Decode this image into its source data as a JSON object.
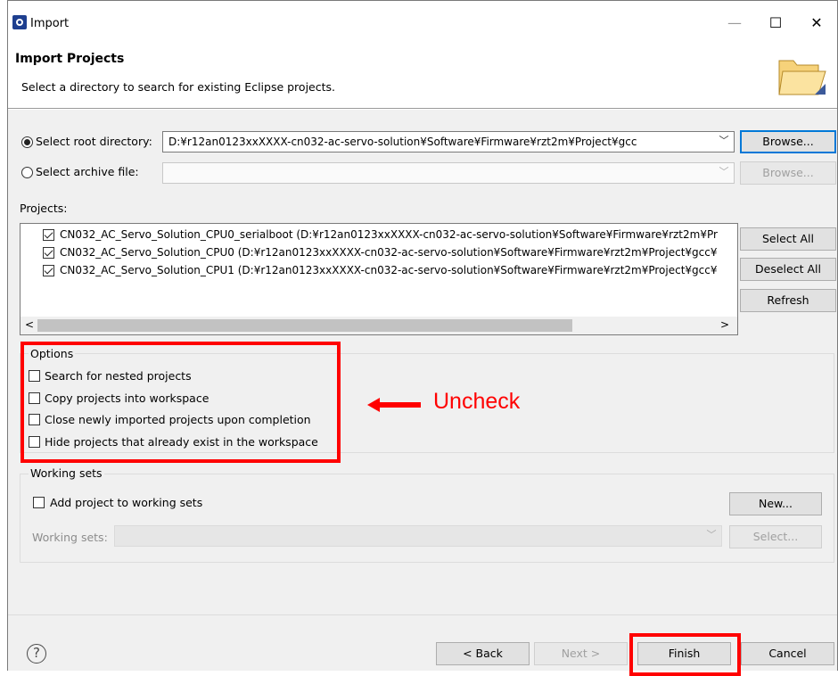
{
  "window": {
    "title": "Import",
    "minimize": "—",
    "maximize": "☐",
    "close": "✕"
  },
  "header": {
    "title": "Import Projects",
    "description": "Select a directory to search for existing Eclipse projects."
  },
  "source": {
    "root_label": "Select root directory:",
    "root_value": "D:¥r12an0123xxXXXX-cn032-ac-servo-solution¥Software¥Firmware¥rzt2m¥Project¥gcc",
    "archive_label": "Select archive file:",
    "archive_value": "",
    "browse_label": "Browse...",
    "browse_archive_label": "Browse..."
  },
  "projects": {
    "label": "Projects:",
    "items": [
      {
        "text": "CN032_AC_Servo_Solution_CPU0_serialboot (D:¥r12an0123xxXXXX-cn032-ac-servo-solution¥Software¥Firmware¥rzt2m¥Pr",
        "checked": true
      },
      {
        "text": "CN032_AC_Servo_Solution_CPU0 (D:¥r12an0123xxXXXX-cn032-ac-servo-solution¥Software¥Firmware¥rzt2m¥Project¥gcc¥",
        "checked": true
      },
      {
        "text": "CN032_AC_Servo_Solution_CPU1 (D:¥r12an0123xxXXXX-cn032-ac-servo-solution¥Software¥Firmware¥rzt2m¥Project¥gcc¥",
        "checked": true
      }
    ],
    "select_all": "Select All",
    "deselect_all": "Deselect All",
    "refresh": "Refresh",
    "scroll_left": "<",
    "scroll_right": ">"
  },
  "options": {
    "label": "Options",
    "items": [
      {
        "label": "Search for nested projects",
        "checked": false
      },
      {
        "label": "Copy projects into workspace",
        "checked": false
      },
      {
        "label": "Close newly imported projects upon completion",
        "checked": false
      },
      {
        "label": "Hide projects that already exist in the workspace",
        "checked": false
      }
    ]
  },
  "annotation": {
    "text": "Uncheck",
    "color": "#ff0000"
  },
  "working_sets": {
    "label": "Working sets",
    "add_label": "Add project to working sets",
    "add_checked": false,
    "sets_label": "Working sets:",
    "sets_value": "",
    "new_label": "New...",
    "select_label": "Select..."
  },
  "footer": {
    "help": "?",
    "back": "< Back",
    "next": "Next >",
    "finish": "Finish",
    "cancel": "Cancel"
  },
  "colors": {
    "highlight": "#ff0000",
    "focus": "#0078d7",
    "dialog_bg": "#f0f0f0"
  }
}
